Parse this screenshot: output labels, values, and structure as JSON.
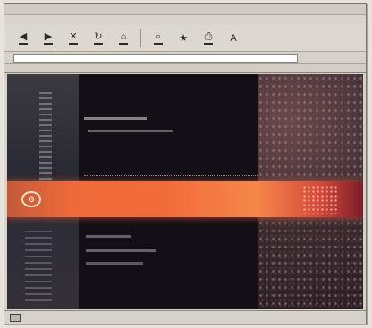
{
  "window": {
    "title": ""
  },
  "menu": {
    "items": [
      "",
      "",
      "",
      "",
      "",
      ""
    ]
  },
  "toolbar": {
    "buttons": [
      {
        "icon": "back-icon"
      },
      {
        "icon": "forward-icon"
      },
      {
        "icon": "stop-icon"
      },
      {
        "icon": "refresh-icon"
      },
      {
        "icon": "home-icon"
      },
      {
        "icon": "search-icon"
      },
      {
        "icon": "favorites-icon"
      },
      {
        "icon": "print-icon"
      },
      {
        "icon": "font-icon"
      }
    ]
  },
  "address": {
    "label": "",
    "value": "",
    "go_label": ""
  },
  "links": {
    "text": ""
  },
  "page": {
    "banner_logo": "G",
    "banner_text": "",
    "section_tabs": [
      "",
      "",
      ""
    ],
    "colors": {
      "banner": "#f26b3b",
      "background": "#140f16",
      "side": "#3a2b30"
    }
  },
  "status": {
    "left": "",
    "right": ""
  }
}
